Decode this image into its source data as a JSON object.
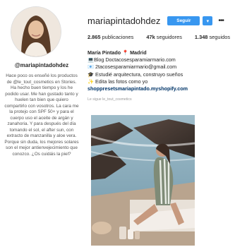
{
  "left_panel": {
    "username": "@mariapintadohdez",
    "caption": "Hace poco os enseñé los productos de @le_tout_cosmetics en Stories. Ha hecho buen tiempo y los he podido usar. Me han gustado tanto y huelen tan bien que quiero compartirlo con vosotros. La cara me la protejo con SPF 50+ y para el cuerpo uso el aceite de argán y zanahoria. Y para después del día tomando el sol, el after sun, con extracto de manzanilla y aloe vera. Porque sin duda, los mejores solares son el mejor antienvejecimiento que conozco. ¿Os cuidáis la piel?"
  },
  "profile": {
    "handle": "mariapintadohdez",
    "follow_label": "Seguir",
    "dropdown_glyph": "▾",
    "more_glyph": "•••",
    "stats": [
      {
        "value": "2.865",
        "label": "publicaciones"
      },
      {
        "value": "47k",
        "label": "seguidores"
      },
      {
        "value": "1.348",
        "label": "seguidos"
      }
    ],
    "bio": {
      "name_line": "María Pintado 📍 Madrid",
      "line1": "💻Blog Doctacosesparamiarmario.com",
      "line2": "📧 2tacosesparamiarmario@gmail.com",
      "line3": "🎓 Estudié arquitectura, construyo sueños",
      "line4": "✨ Edita las fotos como yo",
      "link": "shoppresetsmariapintado.myshopify.com"
    },
    "followed_by": "Le sigue le_tout_cosmetics"
  },
  "colors": {
    "follow_button": "#3897f0",
    "link": "#003569"
  }
}
